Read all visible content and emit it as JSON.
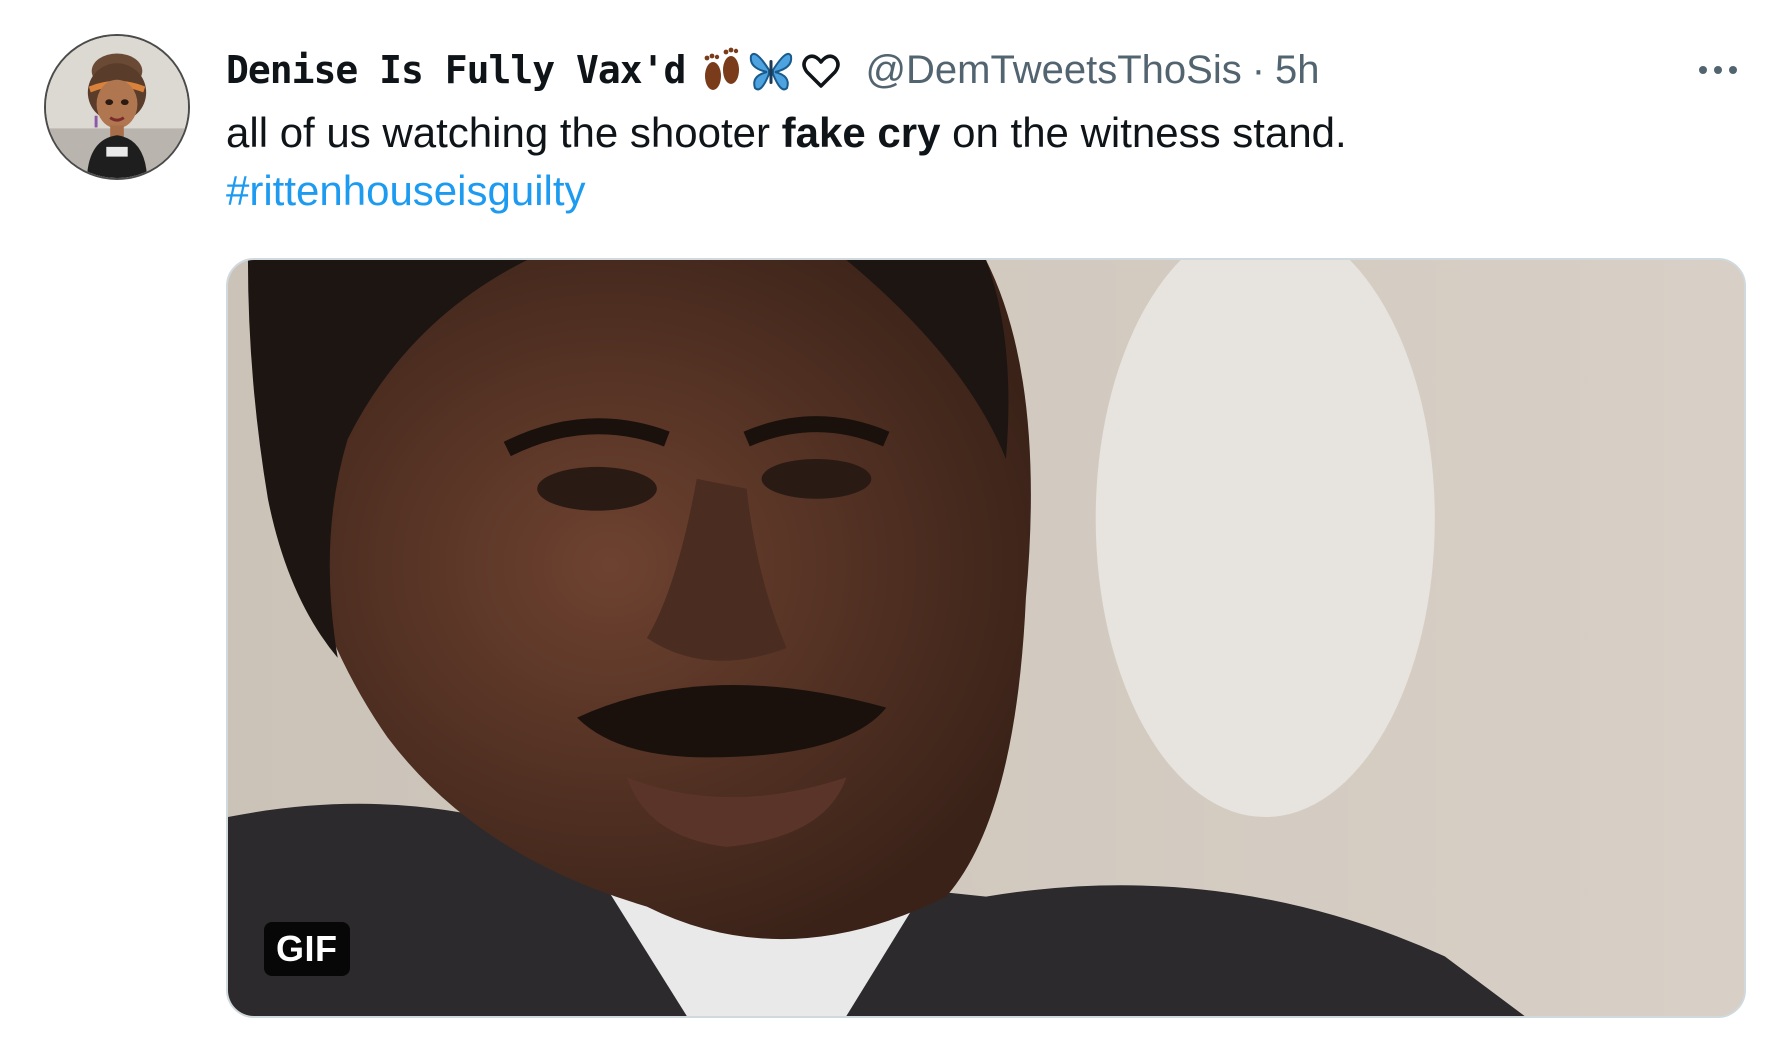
{
  "tweet": {
    "display_name": "Denise Is Fully Vax'd",
    "name_emojis": [
      "footprints-icon",
      "butterfly-icon",
      "heart-outline-icon"
    ],
    "handle": "@DemTweetsThoSis",
    "separator": "·",
    "time": "5h",
    "text_before": "all of us watching the shooter ",
    "text_bold": "fake cry",
    "text_after": " on the witness stand.",
    "hashtag": "#rittenhouseisguilty",
    "media_badge": "GIF"
  },
  "colors": {
    "text": "#0f1419",
    "secondary": "#536471",
    "link": "#1d9bf0",
    "border": "#cfd9de"
  }
}
